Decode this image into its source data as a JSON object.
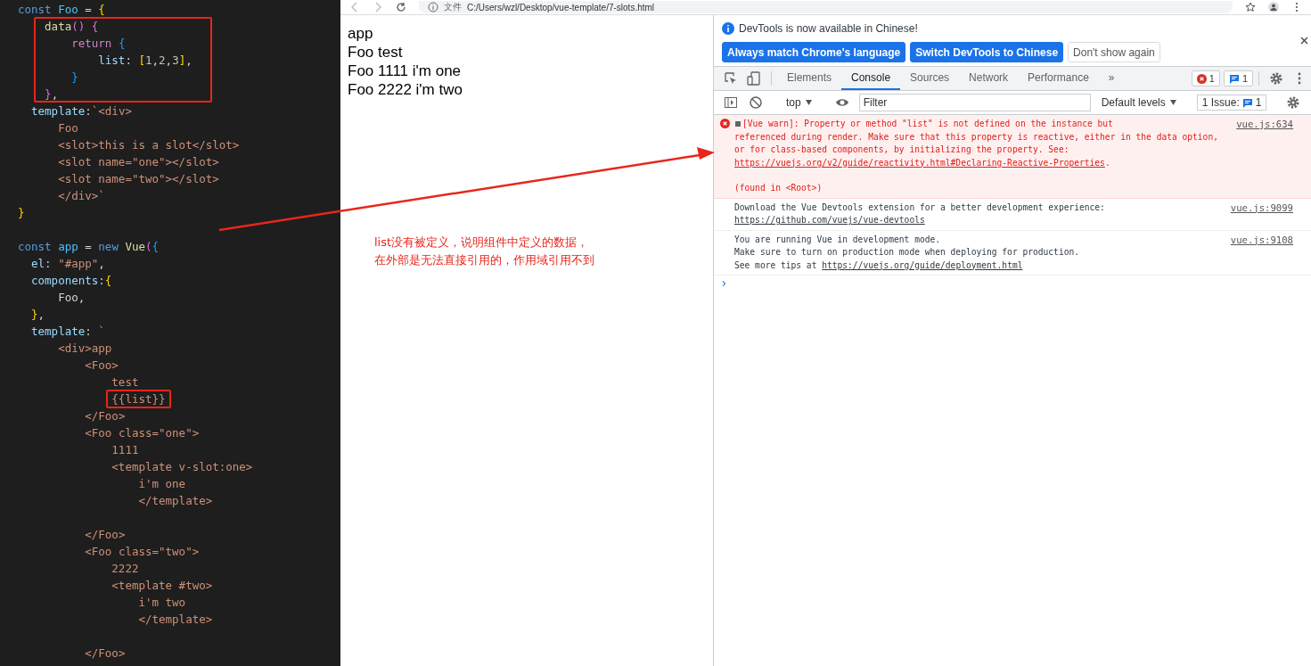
{
  "editor": {
    "lines": [
      {
        "kind": "code",
        "segs": [
          {
            "kind": "kw",
            "text": "const"
          },
          {
            "kind": "var",
            "text": " Foo"
          },
          {
            "kind": "plain",
            "text": " = "
          },
          {
            "kind": "b1",
            "text": "{"
          }
        ]
      },
      {
        "kind": "code",
        "segs": [
          {
            "kind": "fn",
            "text": "    data"
          },
          {
            "kind": "b2",
            "text": "()"
          },
          {
            "kind": "b2",
            "text": " {"
          }
        ]
      },
      {
        "kind": "code",
        "segs": [
          {
            "kind": "kw2",
            "text": "        return"
          },
          {
            "kind": "b3",
            "text": " {"
          }
        ]
      },
      {
        "kind": "code",
        "segs": [
          {
            "kind": "prop",
            "text": "            list"
          },
          {
            "kind": "plain",
            "text": ": "
          },
          {
            "kind": "b1",
            "text": "["
          },
          {
            "kind": "num",
            "text": "1"
          },
          {
            "kind": "plain",
            "text": ","
          },
          {
            "kind": "num",
            "text": "2"
          },
          {
            "kind": "plain",
            "text": ","
          },
          {
            "kind": "num",
            "text": "3"
          },
          {
            "kind": "b1",
            "text": "]"
          },
          {
            "kind": "plain",
            "text": ","
          }
        ]
      },
      {
        "kind": "code",
        "segs": [
          {
            "kind": "b3",
            "text": "        }"
          }
        ]
      },
      {
        "kind": "code",
        "segs": [
          {
            "kind": "b2",
            "text": "    }"
          },
          {
            "kind": "plain",
            "text": ","
          }
        ]
      },
      {
        "kind": "code",
        "segs": [
          {
            "kind": "prop",
            "text": "  template"
          },
          {
            "kind": "plain",
            "text": ":"
          },
          {
            "kind": "str",
            "text": "`<div>"
          }
        ]
      },
      {
        "kind": "code",
        "segs": [
          {
            "kind": "str",
            "text": "      Foo"
          }
        ]
      },
      {
        "kind": "code",
        "segs": [
          {
            "kind": "str",
            "text": "      <slot>this is a slot</slot>"
          }
        ]
      },
      {
        "kind": "code",
        "segs": [
          {
            "kind": "str",
            "text": "      <slot name=\"one\"></slot>"
          }
        ]
      },
      {
        "kind": "code",
        "segs": [
          {
            "kind": "str",
            "text": "      <slot name=\"two\"></slot>"
          }
        ]
      },
      {
        "kind": "code",
        "segs": [
          {
            "kind": "str",
            "text": "      </div>`"
          }
        ]
      },
      {
        "kind": "code",
        "segs": [
          {
            "kind": "b1",
            "text": "}"
          }
        ]
      },
      {
        "kind": "blank"
      },
      {
        "kind": "code",
        "segs": [
          {
            "kind": "kw",
            "text": "const"
          },
          {
            "kind": "var",
            "text": " app"
          },
          {
            "kind": "plain",
            "text": " = "
          },
          {
            "kind": "kw",
            "text": "new"
          },
          {
            "kind": "fn",
            "text": " Vue"
          },
          {
            "kind": "b2",
            "text": "("
          },
          {
            "kind": "b3",
            "text": "{"
          }
        ]
      },
      {
        "kind": "code",
        "segs": [
          {
            "kind": "prop",
            "text": "  el"
          },
          {
            "kind": "plain",
            "text": ": "
          },
          {
            "kind": "str",
            "text": "\"#app\""
          },
          {
            "kind": "plain",
            "text": ","
          }
        ]
      },
      {
        "kind": "code",
        "segs": [
          {
            "kind": "prop",
            "text": "  components"
          },
          {
            "kind": "plain",
            "text": ":"
          },
          {
            "kind": "b1",
            "text": "{"
          }
        ]
      },
      {
        "kind": "code",
        "segs": [
          {
            "kind": "plain",
            "text": "      Foo,"
          }
        ]
      },
      {
        "kind": "code",
        "segs": [
          {
            "kind": "b1",
            "text": "  }"
          },
          {
            "kind": "plain",
            "text": ","
          }
        ]
      },
      {
        "kind": "code",
        "segs": [
          {
            "kind": "prop",
            "text": "  template"
          },
          {
            "kind": "plain",
            "text": ": "
          },
          {
            "kind": "str",
            "text": "`"
          }
        ]
      },
      {
        "kind": "code",
        "segs": [
          {
            "kind": "str",
            "text": "      <div>app"
          }
        ]
      },
      {
        "kind": "code",
        "segs": [
          {
            "kind": "str",
            "text": "          <Foo>"
          }
        ]
      },
      {
        "kind": "code",
        "segs": [
          {
            "kind": "str",
            "text": "              test"
          }
        ]
      },
      {
        "kind": "code",
        "framed": true,
        "segs": [
          {
            "kind": "str",
            "text": "              {{list}}"
          }
        ]
      },
      {
        "kind": "code",
        "segs": [
          {
            "kind": "str",
            "text": "          </Foo>"
          }
        ]
      },
      {
        "kind": "code",
        "segs": [
          {
            "kind": "str",
            "text": "          <Foo class=\"one\">"
          }
        ]
      },
      {
        "kind": "code",
        "segs": [
          {
            "kind": "str",
            "text": "              1111"
          }
        ]
      },
      {
        "kind": "code",
        "segs": [
          {
            "kind": "str",
            "text": "              <template v-slot:one>"
          }
        ]
      },
      {
        "kind": "code",
        "segs": [
          {
            "kind": "str",
            "text": "                  i'm one"
          }
        ]
      },
      {
        "kind": "code",
        "segs": [
          {
            "kind": "str",
            "text": "                  </template>"
          }
        ]
      },
      {
        "kind": "blank"
      },
      {
        "kind": "code",
        "segs": [
          {
            "kind": "str",
            "text": "          </Foo>"
          }
        ]
      },
      {
        "kind": "code",
        "segs": [
          {
            "kind": "str",
            "text": "          <Foo class=\"two\">"
          }
        ]
      },
      {
        "kind": "code",
        "segs": [
          {
            "kind": "str",
            "text": "              2222"
          }
        ]
      },
      {
        "kind": "code",
        "segs": [
          {
            "kind": "str",
            "text": "              <template #two>"
          }
        ]
      },
      {
        "kind": "code",
        "segs": [
          {
            "kind": "str",
            "text": "                  i'm two"
          }
        ]
      },
      {
        "kind": "code",
        "segs": [
          {
            "kind": "str",
            "text": "                  </template>"
          }
        ]
      },
      {
        "kind": "blank"
      },
      {
        "kind": "code",
        "segs": [
          {
            "kind": "str",
            "text": "          </Foo>"
          }
        ]
      }
    ]
  },
  "address_bar": {
    "security": "文件",
    "url": "C:/Users/wzl/Desktop/vue-template/7-slots.html"
  },
  "page": {
    "lines": [
      "app",
      "Foo test",
      "Foo 1111 i'm one",
      "Foo 2222 i'm two"
    ]
  },
  "annotation": {
    "lines": [
      "list没有被定义，说明组件中定义的数据，",
      "在外部是无法直接引用的，作用域引用不到"
    ]
  },
  "devtools": {
    "infobar": {
      "text": "DevTools is now available in Chinese!",
      "buttons": [
        {
          "label": "Always match Chrome's language",
          "kind": "primary"
        },
        {
          "label": "Switch DevTools to Chinese",
          "kind": "primary"
        },
        {
          "label": "Don't show again",
          "kind": "secondary"
        }
      ]
    },
    "tabs": [
      {
        "label": "Elements",
        "selected": false
      },
      {
        "label": "Console",
        "selected": true
      },
      {
        "label": "Sources",
        "selected": false
      },
      {
        "label": "Network",
        "selected": false
      },
      {
        "label": "Performance",
        "selected": false
      }
    ],
    "more_tabs": "»",
    "error_count": "1",
    "message_count": "1",
    "toolbar": {
      "context": "top",
      "filter_placeholder": "Filter",
      "levels": "Default levels",
      "issues_label": "1 Issue:",
      "issues_count": "1"
    },
    "messages": [
      {
        "kind": "error",
        "text": "[Vue warn]: Property or method \"list\" is not defined on the instance but\nreferenced during render. Make sure that this property is reactive, either in the data option,\nor for class-based components, by initializing the property. See: ",
        "link": "https://vuejs.org/v2/guide/reactivity.html#Declaring-Reactive-Properties",
        "tail": ".",
        "note": "(found in <Root>)",
        "source": "vue.js:634"
      },
      {
        "kind": "info",
        "text": "Download the Vue Devtools extension for a better development experience:\n",
        "link": "https://github.com/vuejs/vue-devtools",
        "source": "vue.js:9099"
      },
      {
        "kind": "info",
        "text": "You are running Vue in development mode.\nMake sure to turn on production mode when deploying for production.\nSee more tips at ",
        "link": "https://vuejs.org/guide/deployment.html",
        "source": "vue.js:9108"
      }
    ],
    "prompt": "›"
  }
}
